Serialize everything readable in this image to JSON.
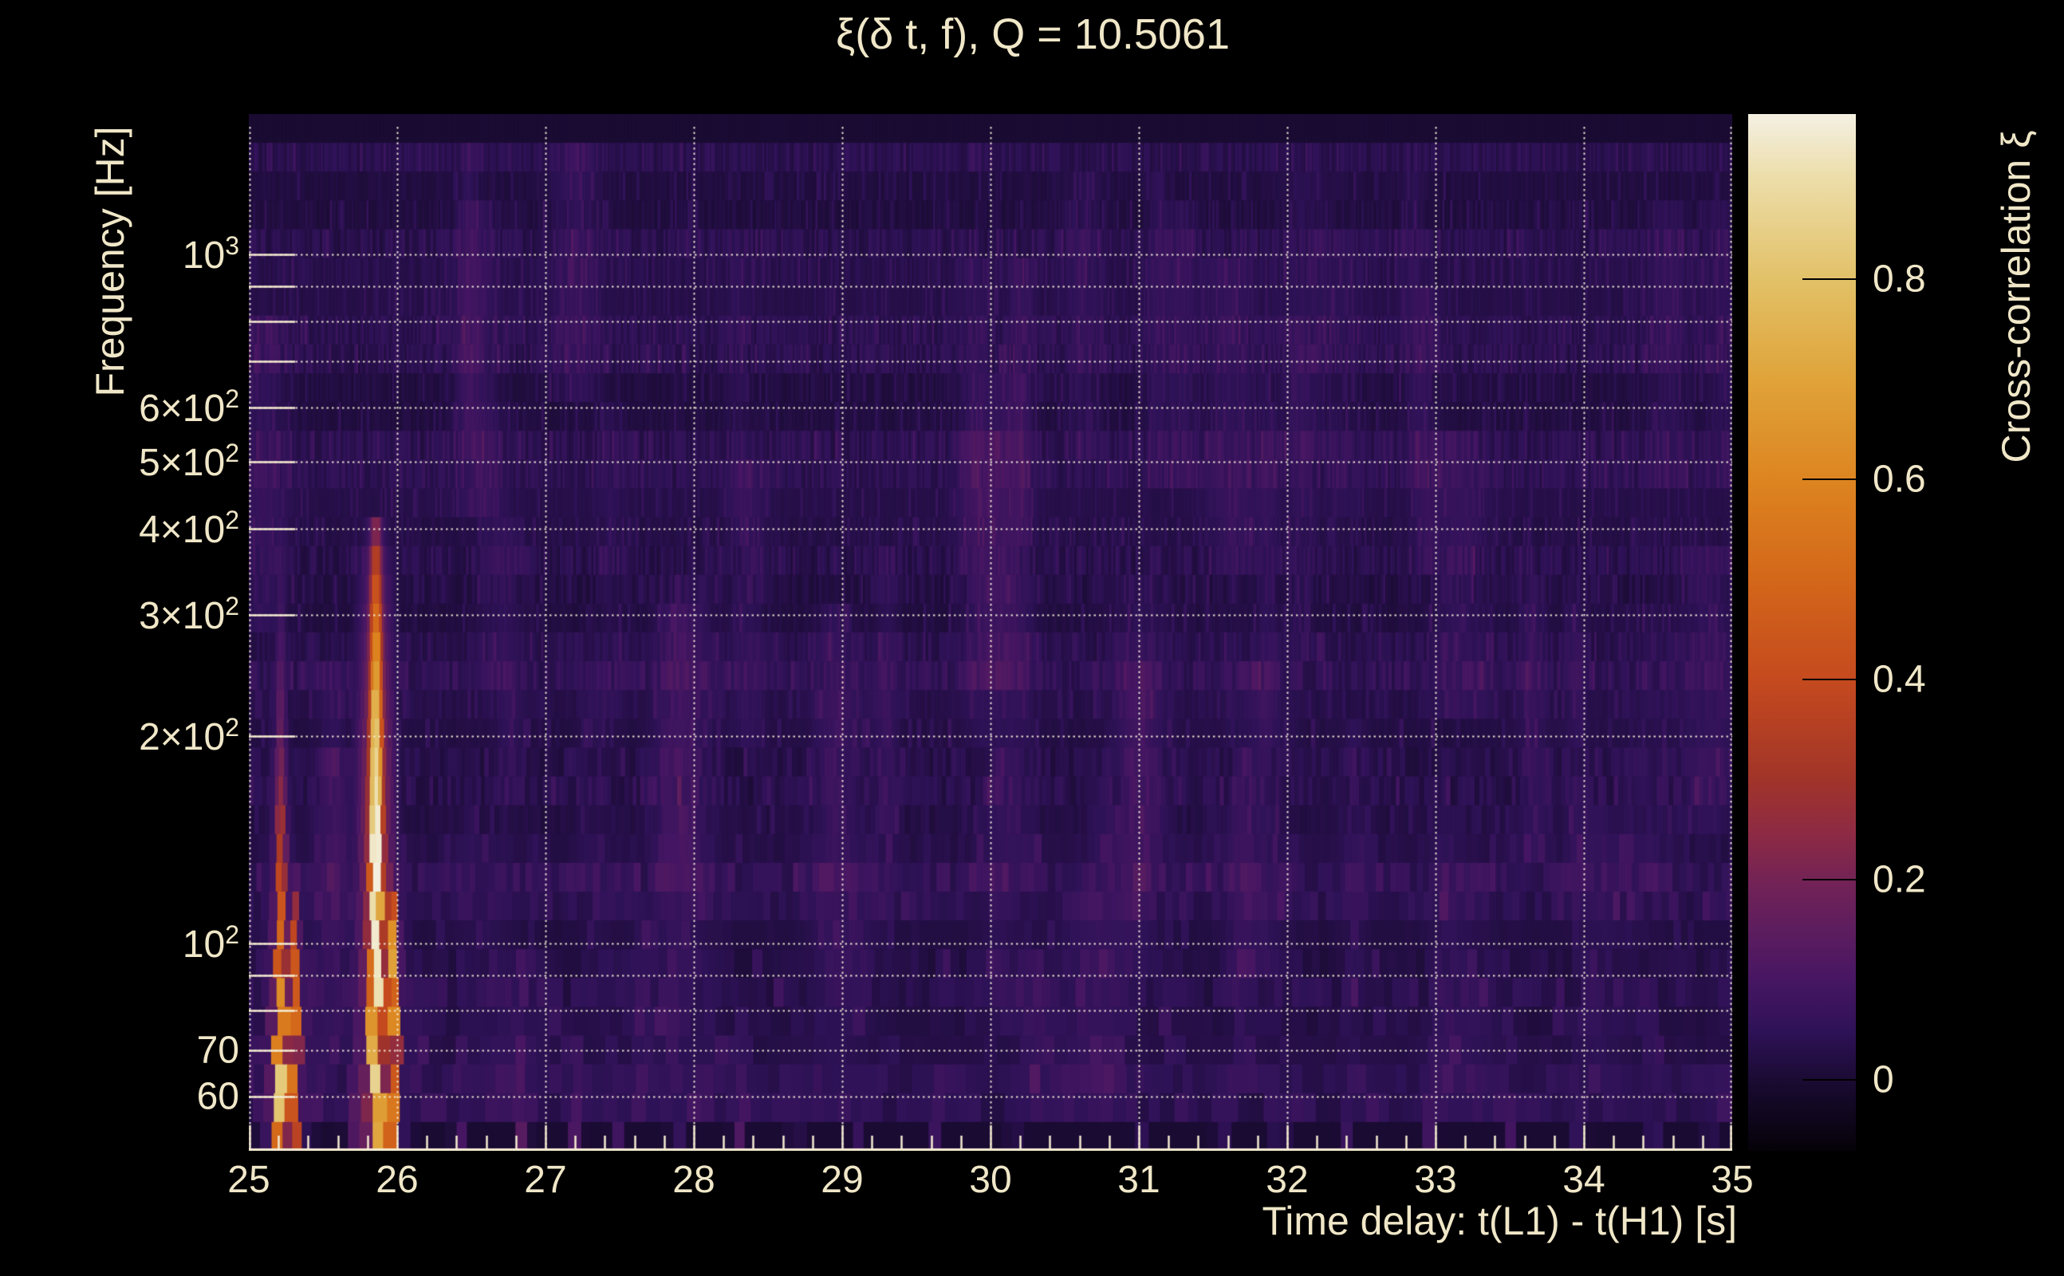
{
  "chart_data": {
    "type": "heatmap",
    "title": "ξ(δ t, f), Q = 10.5061",
    "q_value": 10.5061,
    "xlabel": "Time delay: t(L1) - t(H1) [s]",
    "ylabel": "Frequency [Hz]",
    "colorbar_label": "Cross-correlation ξ",
    "background": "#000000",
    "text_color": "#f0e7c8",
    "grid_color": "#f8f1db",
    "x_range": [
      25,
      35
    ],
    "x_ticks": [
      25,
      26,
      27,
      28,
      29,
      30,
      31,
      32,
      33,
      34,
      35
    ],
    "x_minor_step": 0.2,
    "y_scale": "log",
    "y_range_hz": [
      50,
      1600
    ],
    "y_data_band_hz": [
      55,
      1500
    ],
    "y_ticks": [
      {
        "f": 1000,
        "coef": "10",
        "exp": "3"
      },
      {
        "f": 600,
        "coef": "6×10",
        "exp": "2"
      },
      {
        "f": 500,
        "coef": "5×10",
        "exp": "2"
      },
      {
        "f": 400,
        "coef": "4×10",
        "exp": "2"
      },
      {
        "f": 300,
        "coef": "3×10",
        "exp": "2"
      },
      {
        "f": 200,
        "coef": "2×10",
        "exp": "2"
      },
      {
        "f": 100,
        "coef": "10",
        "exp": "2"
      },
      {
        "f": 70,
        "coef": "70"
      },
      {
        "f": 60,
        "coef": "60"
      }
    ],
    "y_gridlines_hz": [
      60,
      70,
      80,
      90,
      100,
      200,
      300,
      400,
      500,
      600,
      700,
      800,
      900,
      1000
    ],
    "colorbar": {
      "min": -0.071,
      "max": 0.965,
      "ticks": [
        {
          "v": 0.8,
          "label": "0.8"
        },
        {
          "v": 0.6,
          "label": "0.6"
        },
        {
          "v": 0.4,
          "label": "0.4"
        },
        {
          "v": 0.2,
          "label": "0.2"
        },
        {
          "v": 0,
          "label": "0"
        }
      ]
    },
    "colormap_stops": [
      [
        -0.071,
        "#050208"
      ],
      [
        0,
        "#1a0b33"
      ],
      [
        0.05,
        "#2f1258"
      ],
      [
        0.1,
        "#471663"
      ],
      [
        0.15,
        "#5d1d5e"
      ],
      [
        0.2,
        "#742355"
      ],
      [
        0.25,
        "#8f2b42"
      ],
      [
        0.3,
        "#a13429"
      ],
      [
        0.4,
        "#c54a1e"
      ],
      [
        0.5,
        "#d3671a"
      ],
      [
        0.6,
        "#dd8520"
      ],
      [
        0.7,
        "#e0a33a"
      ],
      [
        0.8,
        "#e2c168"
      ],
      [
        0.9,
        "#ecdda8"
      ],
      [
        0.965,
        "#f4f0e3"
      ]
    ],
    "streaks": [
      {
        "t": 25.215,
        "sigma": 0.022,
        "halo": 0.25,
        "profile": [
          [
            370,
            0.06
          ],
          [
            300,
            0.08
          ],
          [
            200,
            0.16
          ],
          [
            150,
            0.28
          ],
          [
            110,
            0.45
          ],
          [
            95,
            0.55
          ],
          [
            80,
            0.66
          ],
          [
            70,
            0.8
          ],
          [
            60,
            0.85
          ],
          [
            55,
            0.76
          ],
          [
            50,
            0.55
          ]
        ]
      },
      {
        "t": 25.305,
        "sigma": 0.02,
        "halo": 0.2,
        "profile": [
          [
            130,
            0.08
          ],
          [
            110,
            0.3
          ],
          [
            100,
            0.42
          ],
          [
            80,
            0.5
          ],
          [
            65,
            0.55
          ],
          [
            55,
            0.5
          ],
          [
            50,
            0.4
          ]
        ]
      },
      {
        "t": 25.72,
        "sigma": 0.03,
        "halo": 0,
        "profile": [
          [
            110,
            0.05
          ],
          [
            80,
            0.1
          ],
          [
            60,
            0.13
          ],
          [
            50,
            0.13
          ]
        ]
      },
      {
        "t": 25.857,
        "sigma": 0.024,
        "halo": 0.3,
        "profile": [
          [
            415,
            0.12
          ],
          [
            380,
            0.3
          ],
          [
            330,
            0.42
          ],
          [
            300,
            0.5
          ],
          [
            260,
            0.62
          ],
          [
            220,
            0.75
          ],
          [
            180,
            0.88
          ],
          [
            150,
            0.95
          ],
          [
            120,
            0.96
          ],
          [
            100,
            0.94
          ],
          [
            80,
            0.9
          ],
          [
            65,
            0.87
          ],
          [
            55,
            0.8
          ],
          [
            50,
            0.62
          ]
        ]
      },
      {
        "t": 25.963,
        "sigma": 0.021,
        "halo": 0.2,
        "profile": [
          [
            128,
            0.12
          ],
          [
            115,
            0.45
          ],
          [
            100,
            0.68
          ],
          [
            90,
            0.7
          ],
          [
            75,
            0.62
          ],
          [
            60,
            0.58
          ],
          [
            50,
            0.45
          ]
        ]
      },
      {
        "t": 26.42,
        "sigma": 0.028,
        "halo": 0,
        "profile": [
          [
            95,
            0.05
          ],
          [
            60,
            0.1
          ],
          [
            50,
            0.12
          ]
        ]
      },
      {
        "t": 26.85,
        "sigma": 0.026,
        "halo": 0,
        "profile": [
          [
            100,
            0.07
          ],
          [
            70,
            0.13
          ],
          [
            50,
            0.16
          ]
        ]
      },
      {
        "t": 27.2,
        "sigma": 0.028,
        "halo": 0,
        "profile": [
          [
            90,
            0.05
          ],
          [
            60,
            0.1
          ],
          [
            50,
            0.11
          ]
        ]
      },
      {
        "t": 27.48,
        "sigma": 0.025,
        "halo": 0,
        "profile": [
          [
            75,
            0.05
          ],
          [
            50,
            0.1
          ]
        ]
      },
      {
        "t": 27.88,
        "sigma": 0.025,
        "halo": 0,
        "profile": [
          [
            80,
            0.05
          ],
          [
            50,
            0.1
          ]
        ]
      },
      {
        "t": 28.3,
        "sigma": 0.027,
        "halo": 0,
        "profile": [
          [
            90,
            0.06
          ],
          [
            60,
            0.11
          ],
          [
            50,
            0.13
          ]
        ]
      },
      {
        "t": 28.68,
        "sigma": 0.025,
        "halo": 0,
        "profile": [
          [
            70,
            0.05
          ],
          [
            50,
            0.09
          ]
        ]
      },
      {
        "t": 29.1,
        "sigma": 0.025,
        "halo": 0,
        "profile": [
          [
            60,
            0.04
          ],
          [
            50,
            0.08
          ]
        ]
      },
      {
        "t": 29.62,
        "sigma": 0.025,
        "halo": 0,
        "profile": [
          [
            70,
            0.04
          ],
          [
            50,
            0.08
          ]
        ]
      },
      {
        "t": 30.15,
        "sigma": 0.025,
        "halo": 0,
        "profile": [
          [
            60,
            0.04
          ],
          [
            50,
            0.07
          ]
        ]
      },
      {
        "t": 31.0,
        "sigma": 0.025,
        "halo": 0,
        "profile": [
          [
            60,
            0.04
          ],
          [
            50,
            0.07
          ]
        ]
      },
      {
        "t": 31.55,
        "sigma": 0.025,
        "halo": 0,
        "profile": [
          [
            70,
            0.05
          ],
          [
            50,
            0.09
          ]
        ]
      },
      {
        "t": 31.95,
        "sigma": 0.03,
        "halo": 0,
        "profile": [
          [
            100,
            0.05
          ],
          [
            70,
            0.08
          ],
          [
            50,
            0.1
          ]
        ]
      },
      {
        "t": 32.4,
        "sigma": 0.025,
        "halo": 0,
        "profile": [
          [
            60,
            0.04
          ],
          [
            50,
            0.08
          ]
        ]
      },
      {
        "t": 32.97,
        "sigma": 0.025,
        "halo": 0,
        "profile": [
          [
            80,
            0.05
          ],
          [
            50,
            0.11
          ]
        ]
      },
      {
        "t": 33.5,
        "sigma": 0.025,
        "halo": 0,
        "profile": [
          [
            80,
            0.05
          ],
          [
            50,
            0.1
          ]
        ]
      },
      {
        "t": 33.97,
        "sigma": 0.025,
        "halo": 0,
        "profile": [
          [
            70,
            0.04
          ],
          [
            50,
            0.09
          ]
        ]
      },
      {
        "t": 34.47,
        "sigma": 0.026,
        "halo": 0,
        "profile": [
          [
            80,
            0.05
          ],
          [
            60,
            0.09
          ],
          [
            50,
            0.11
          ]
        ]
      },
      {
        "t": 34.85,
        "sigma": 0.025,
        "halo": 0,
        "profile": [
          [
            60,
            0.04
          ],
          [
            50,
            0.08
          ]
        ]
      }
    ],
    "noise": {
      "seed": 42,
      "rows": 36,
      "smudges": 70
    }
  }
}
